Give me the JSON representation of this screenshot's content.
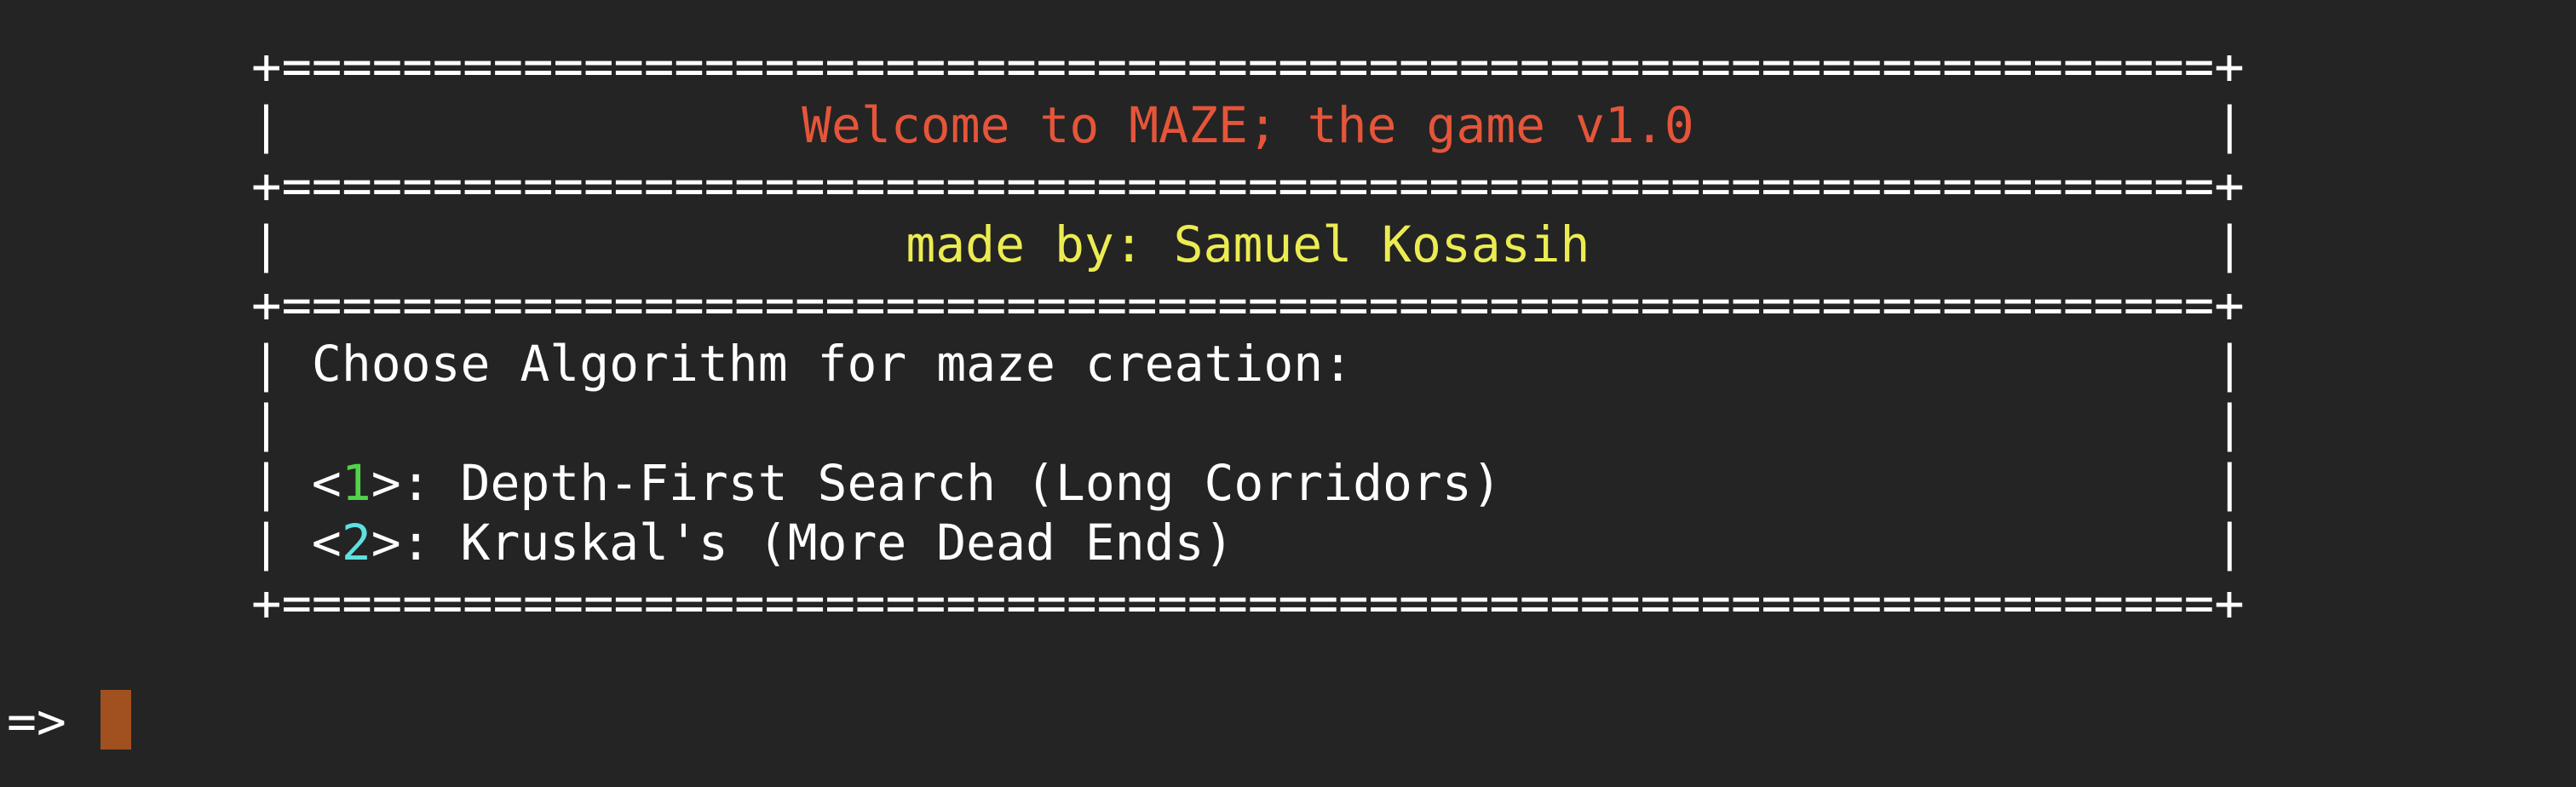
{
  "terminal": {
    "border_line": "+================================================================+",
    "row_start": "|",
    "row_end": "|",
    "title": "Welcome to MAZE; the game v1.0",
    "author": "made by: Samuel Kosasih",
    "prompt_heading": "Choose Algorithm for maze creation:",
    "options": [
      {
        "open": "<",
        "key": "1",
        "close": ">",
        "label": ": Depth-First Search (Long Corridors)"
      },
      {
        "open": "<",
        "key": "2",
        "close": ">",
        "label": ": Kruskal's (More Dead Ends)"
      }
    ],
    "input_prompt": "=>",
    "colors": {
      "background": "#242424",
      "title": "#e5553a",
      "author": "#ecec52",
      "option_1_key": "#52d24a",
      "option_2_key": "#5fe0e0",
      "cursor": "#a1501f"
    }
  }
}
